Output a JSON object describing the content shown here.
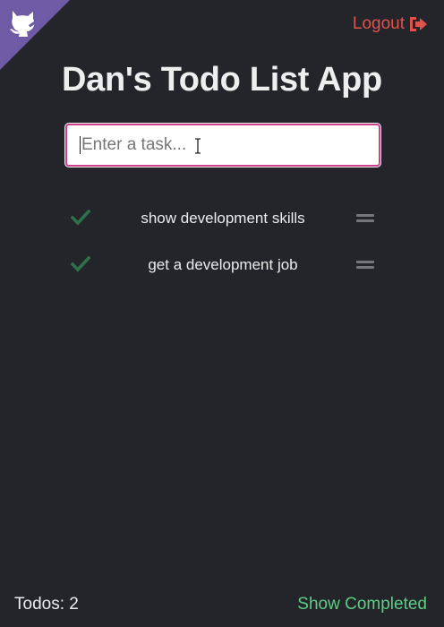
{
  "app": {
    "title": "Dan's Todo List App"
  },
  "header": {
    "logout_label": "Logout",
    "corner_icon": "octocat-icon",
    "logout_icon": "sign-out-icon"
  },
  "task_input": {
    "value": "",
    "placeholder": "Enter a task..."
  },
  "todos": [
    {
      "text": "show development skills",
      "icon": "check-icon"
    },
    {
      "text": "get a development job",
      "icon": "check-icon"
    }
  ],
  "footer": {
    "count_label": "Todos: 2",
    "show_completed_label": "Show Completed"
  },
  "colors": {
    "background": "#23252b",
    "corner": "#6f5aa6",
    "logout": "#e2524b",
    "input_border": "#cc3f8a",
    "check": "#2f6f4a",
    "show_completed": "#5ecc84"
  }
}
